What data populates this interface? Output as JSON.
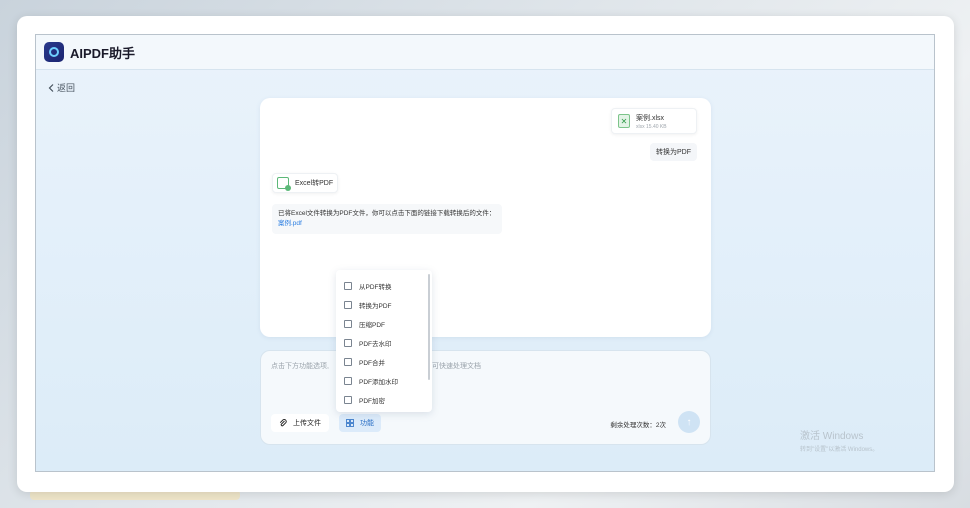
{
  "app": {
    "title": "AIPDF助手"
  },
  "nav": {
    "back_label": "返回"
  },
  "chat": {
    "file_card": {
      "name": "案例.xlsx",
      "meta": "xlsx 15.40 KB"
    },
    "user_message": "转换为PDF",
    "tool_card": {
      "label": "Excel转PDF"
    },
    "assistant_message": "已将Excel文件转换为PDF文件，你可以点击下面的链接下载转换后的文件：",
    "result_link": "案例.pdf"
  },
  "dropdown": {
    "items": [
      {
        "label": "从PDF转换",
        "icon": "convert-from-pdf-icon"
      },
      {
        "label": "转换为PDF",
        "icon": "convert-to-pdf-icon"
      },
      {
        "label": "压缩PDF",
        "icon": "compress-pdf-icon"
      },
      {
        "label": "PDF去水印",
        "icon": "remove-watermark-icon"
      },
      {
        "label": "PDF合并",
        "icon": "merge-pdf-icon"
      },
      {
        "label": "PDF添加水印",
        "icon": "add-watermark-icon"
      },
      {
        "label": "PDF加密",
        "icon": "encrypt-pdf-icon"
      }
    ]
  },
  "composer": {
    "placeholder_left": "点击下方功能选项,",
    "placeholder_right": "可快速处理文档",
    "upload_label": "上传文件",
    "function_label": "功能",
    "remaining_label": "剩余处理次数：",
    "remaining_count": "2次"
  },
  "watermark": {
    "line1": "激活 Windows",
    "line2": "转到\"设置\"以激活 Windows。"
  },
  "colors": {
    "accent": "#2a7de1",
    "brand": "#1a2470",
    "excel_green": "#2f9b48"
  }
}
